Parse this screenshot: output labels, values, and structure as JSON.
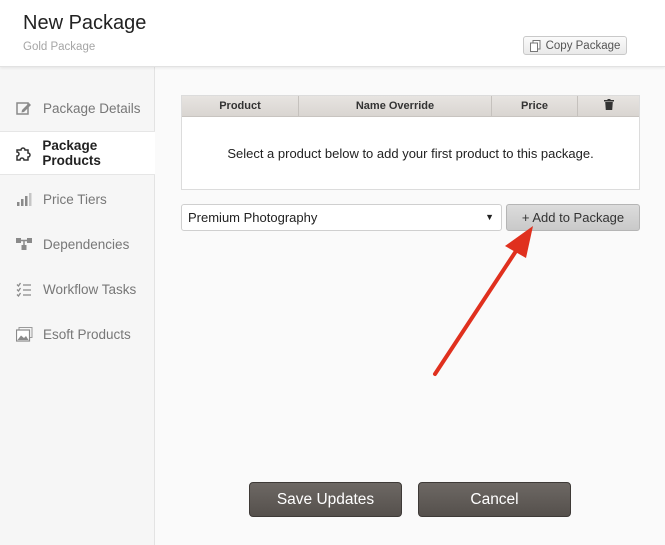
{
  "header": {
    "title": "New Package",
    "subtitle": "Gold Package",
    "copy_label": "Copy Package"
  },
  "sidebar": {
    "items": [
      {
        "label": "Package Details",
        "icon": "pencil-icon"
      },
      {
        "label": "Package Products",
        "icon": "puzzle-icon",
        "active": true
      },
      {
        "label": "Price Tiers",
        "icon": "bar-chart-icon"
      },
      {
        "label": "Dependencies",
        "icon": "hierarchy-icon"
      },
      {
        "label": "Workflow Tasks",
        "icon": "checklist-icon"
      },
      {
        "label": "Esoft Products",
        "icon": "image-icon"
      }
    ]
  },
  "table": {
    "columns": [
      "Product",
      "Name Override",
      "Price"
    ],
    "delete_icon": "trash-icon",
    "empty_message": "Select a product below to add your first product to this package."
  },
  "product_select": {
    "value": "Premium Photography"
  },
  "add_button": {
    "label": "+ Add to Package"
  },
  "footer": {
    "save_label": "Save Updates",
    "cancel_label": "Cancel"
  },
  "colors": {
    "annotation_arrow": "#e0301e",
    "dark_button": "#5e5955",
    "sidebar_bg": "#f6f6f6"
  }
}
